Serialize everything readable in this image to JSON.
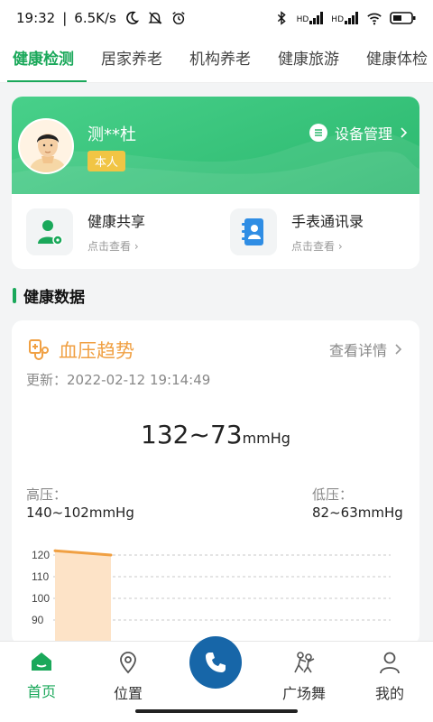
{
  "status": {
    "time": "19:32",
    "speed": "6.5K/s",
    "network": "HD",
    "battery_icon": "battery-icon"
  },
  "tabs": [
    {
      "label": "健康检测",
      "active": true
    },
    {
      "label": "居家养老"
    },
    {
      "label": "机构养老"
    },
    {
      "label": "健康旅游"
    },
    {
      "label": "健康体检"
    }
  ],
  "profile": {
    "name": "测**杜",
    "tag": "本人",
    "device_label": "设备管理",
    "shortcuts": [
      {
        "title": "健康共享",
        "sub": "点击查看 ›",
        "icon": "health-share-icon"
      },
      {
        "title": "手表通讯录",
        "sub": "点击查看 ›",
        "icon": "contacts-icon"
      }
    ]
  },
  "section": {
    "title": "健康数据"
  },
  "bp": {
    "title": "血压趋势",
    "detail_label": "查看详情",
    "updated": "更新：2022-02-12 19:14:49",
    "reading": "132~73",
    "unit": "mmHg",
    "high_label": "高压：",
    "high_value": "140~102mmHg",
    "low_label": "低压：",
    "low_value": "82~63mmHg"
  },
  "chart_data": {
    "type": "area",
    "y_ticks": [
      "120",
      "110",
      "100",
      "90"
    ],
    "ylim": [
      85,
      125
    ],
    "series": [
      {
        "values": [
          122,
          120
        ]
      }
    ],
    "grid": true,
    "color": "#f0a043"
  },
  "nav": {
    "home": "首页",
    "location": "位置",
    "dance": "广场舞",
    "mine": "我的"
  },
  "colors": {
    "accent": "#1aa85a",
    "bp_accent": "#f0a043",
    "call": "#1766a8"
  }
}
